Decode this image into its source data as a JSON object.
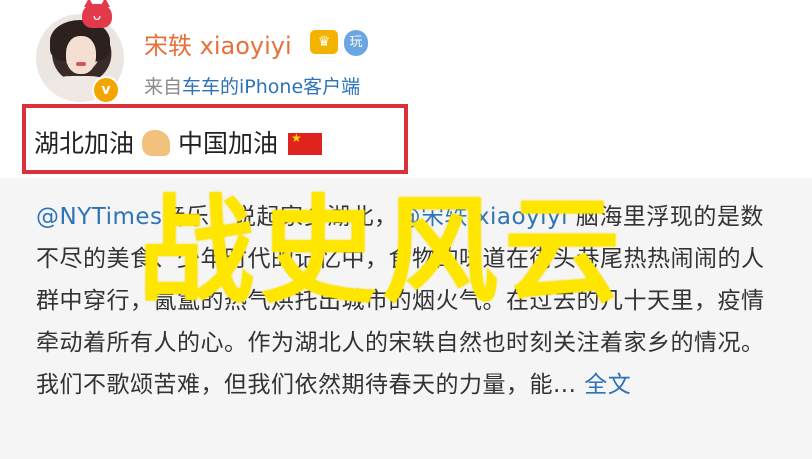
{
  "post": {
    "username": "宋轶 xiaoyiyi",
    "source_prefix": "来自",
    "source_device": "车车的iPhone客户端",
    "text_part1": "湖北加油",
    "text_part2": "中国加油",
    "badges": {
      "avatar_verified": "v",
      "vip_label": "玩"
    }
  },
  "repost": {
    "mention1": "@NYTimes",
    "text1": "音乐：说起家乡湖北，",
    "mention2": "@宋轶 xiaoyiyi",
    "text2": "脑海里浮现的是数不尽的美食、少年时代的记忆中，食物的味道在街头巷尾热热闹闹的人群中穿行，氤氲的热气烘托出城市的烟火气。在过去的几十天里，疫情牵动着所有人的心。作为湖北人的宋轶自然也时刻关注着家乡的情况。我们不歌颂苦难，但我们依然期待春天的力量，能...",
    "full_text_link": "全文"
  },
  "watermark": "战史风云",
  "icons": [
    "cat-ear-icon",
    "verified-v-icon",
    "crown-icon",
    "vip-icon",
    "muscle-icon",
    "china-flag-icon"
  ],
  "colors": {
    "username": "#e8703a",
    "link": "#2d73b8",
    "highlight_border": "#d9323a",
    "watermark": "#ffe600",
    "repost_bg": "#f5f5f5"
  }
}
